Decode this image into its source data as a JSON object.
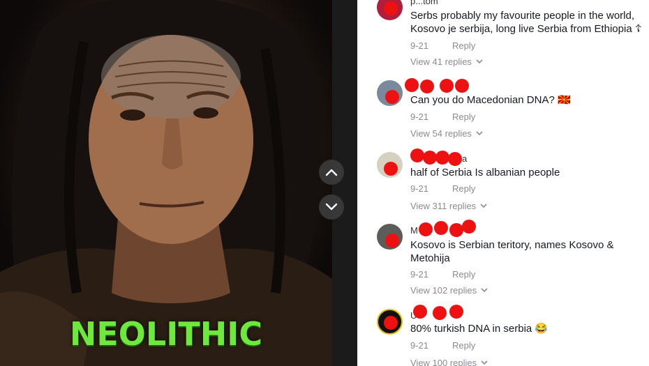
{
  "video": {
    "overlay_text": "NEOLITHIC",
    "overlay_color": "#6ee83c",
    "prev_icon": "chevron-up-icon",
    "next_icon": "chevron-down-icon"
  },
  "comments": [
    {
      "username": "p...tom",
      "text": "Serbs probably my favourite people in the world, Kosovo je serbija, long live Serbia from Ethiopia ☦",
      "date": "9-21",
      "reply_label": "Reply",
      "view_replies": "View 41 replies"
    },
    {
      "username": "",
      "text": "Can you do Macedonian DNA? 🇲🇰",
      "date": "9-21",
      "reply_label": "Reply",
      "view_replies": "View 54 replies"
    },
    {
      "username": "a",
      "text": "half of Serbia Is albanian people",
      "date": "9-21",
      "reply_label": "Reply",
      "view_replies": "View 311 replies"
    },
    {
      "username": "M",
      "text": "Kosovo is Serbian teritory, names Kosovo & Metohija",
      "date": "9-21",
      "reply_label": "Reply",
      "view_replies": "View 102 replies"
    },
    {
      "username": "U",
      "text": "80% turkish DNA in serbia 😂",
      "date": "9-21",
      "reply_label": "Reply",
      "view_replies": "View 100 replies"
    }
  ],
  "colors": {
    "redaction": "#ee1111",
    "meta_text": "#8a8b91",
    "comment_text": "#161823"
  }
}
